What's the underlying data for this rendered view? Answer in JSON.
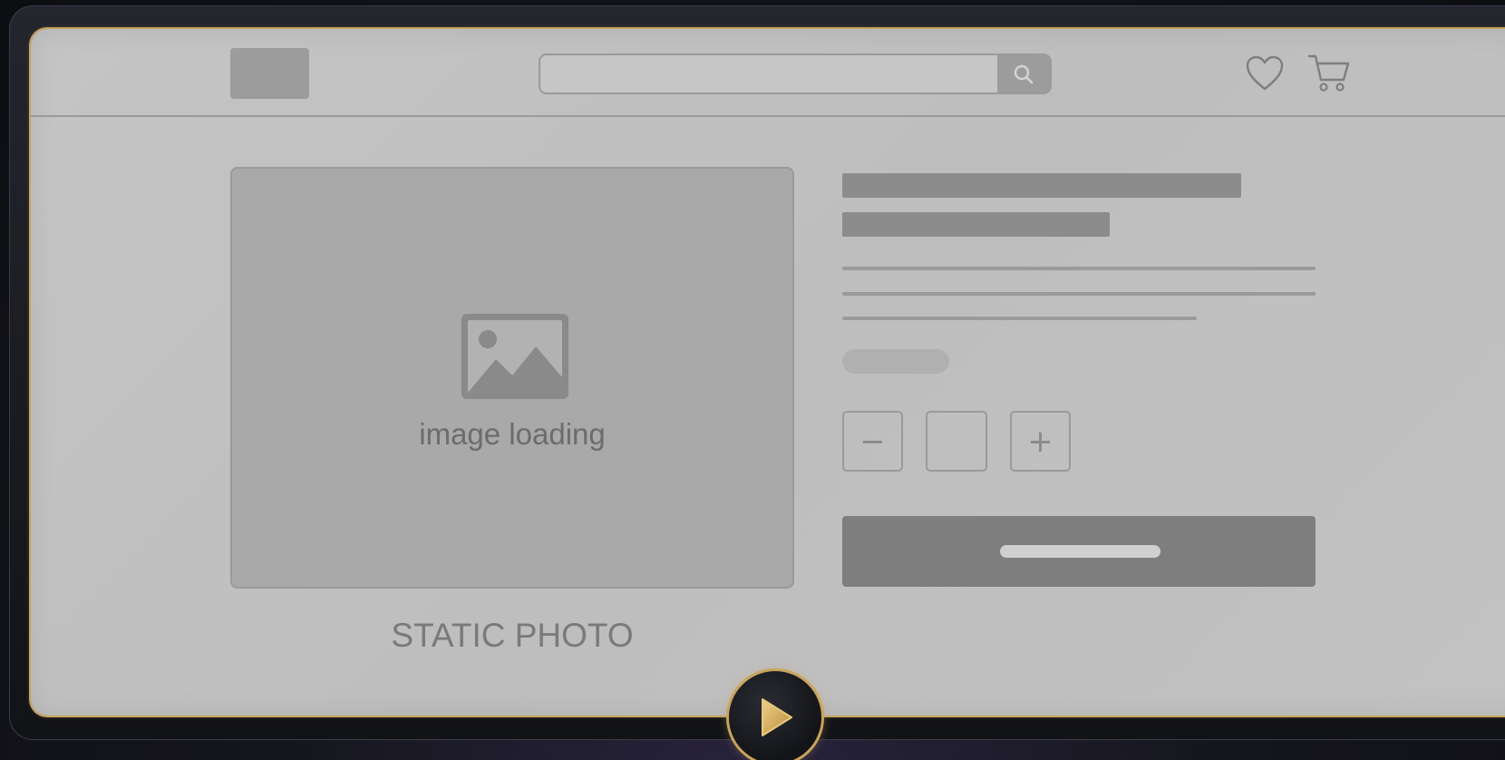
{
  "search": {
    "value": "",
    "placeholder": ""
  },
  "icons": {
    "search": "search-icon",
    "wishlist": "heart-icon",
    "cart": "cart-icon",
    "image": "image-placeholder-icon",
    "play": "play-icon"
  },
  "product": {
    "image_status": "image loading",
    "caption": "STATIC PHOTO"
  },
  "quantity": {
    "decrement_label": "−",
    "increment_label": "+",
    "value": ""
  },
  "colors": {
    "accent_gold": "#c9a45c",
    "screen_bg": "#c2c2c2",
    "placeholder_gray": "#8c8c8c"
  }
}
